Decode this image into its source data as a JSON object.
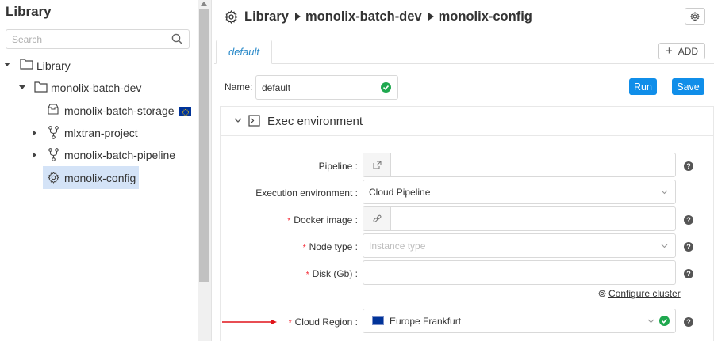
{
  "library": {
    "title": "Library",
    "search_placeholder": "Search",
    "tree": {
      "root": "Library",
      "folder": "monolix-batch-dev",
      "storage": "monolix-batch-storage",
      "pipeline_1": "mlxtran-project",
      "pipeline_2": "monolix-batch-pipeline",
      "config": "monolix-config"
    }
  },
  "breadcrumb": {
    "root": "Library",
    "folder": "monolix-batch-dev",
    "current": "monolix-config"
  },
  "tabs": {
    "default_label": "default",
    "add_label": "ADD"
  },
  "config": {
    "name_label": "Name:",
    "name_value": "default",
    "run_label": "Run",
    "save_label": "Save"
  },
  "exec": {
    "section_title": "Exec environment",
    "pipeline_label": "Pipeline",
    "pipeline_value": "",
    "exec_env_label": "Execution environment",
    "exec_env_value": "Cloud Pipeline",
    "docker_label": "Docker image",
    "docker_value": "",
    "node_type_label": "Node type",
    "node_type_placeholder": "Instance type",
    "disk_label": "Disk (Gb)",
    "disk_value": "",
    "configure_cluster_label": "Configure cluster",
    "cloud_region_label": "Cloud Region",
    "cloud_region_value": "Europe Frankfurt"
  },
  "colors": {
    "accent": "#108ee9",
    "selected_bg": "#d4e3f7",
    "ok_green": "#1fa84f",
    "required": "#f5222d",
    "arrow": "#e0141a"
  }
}
